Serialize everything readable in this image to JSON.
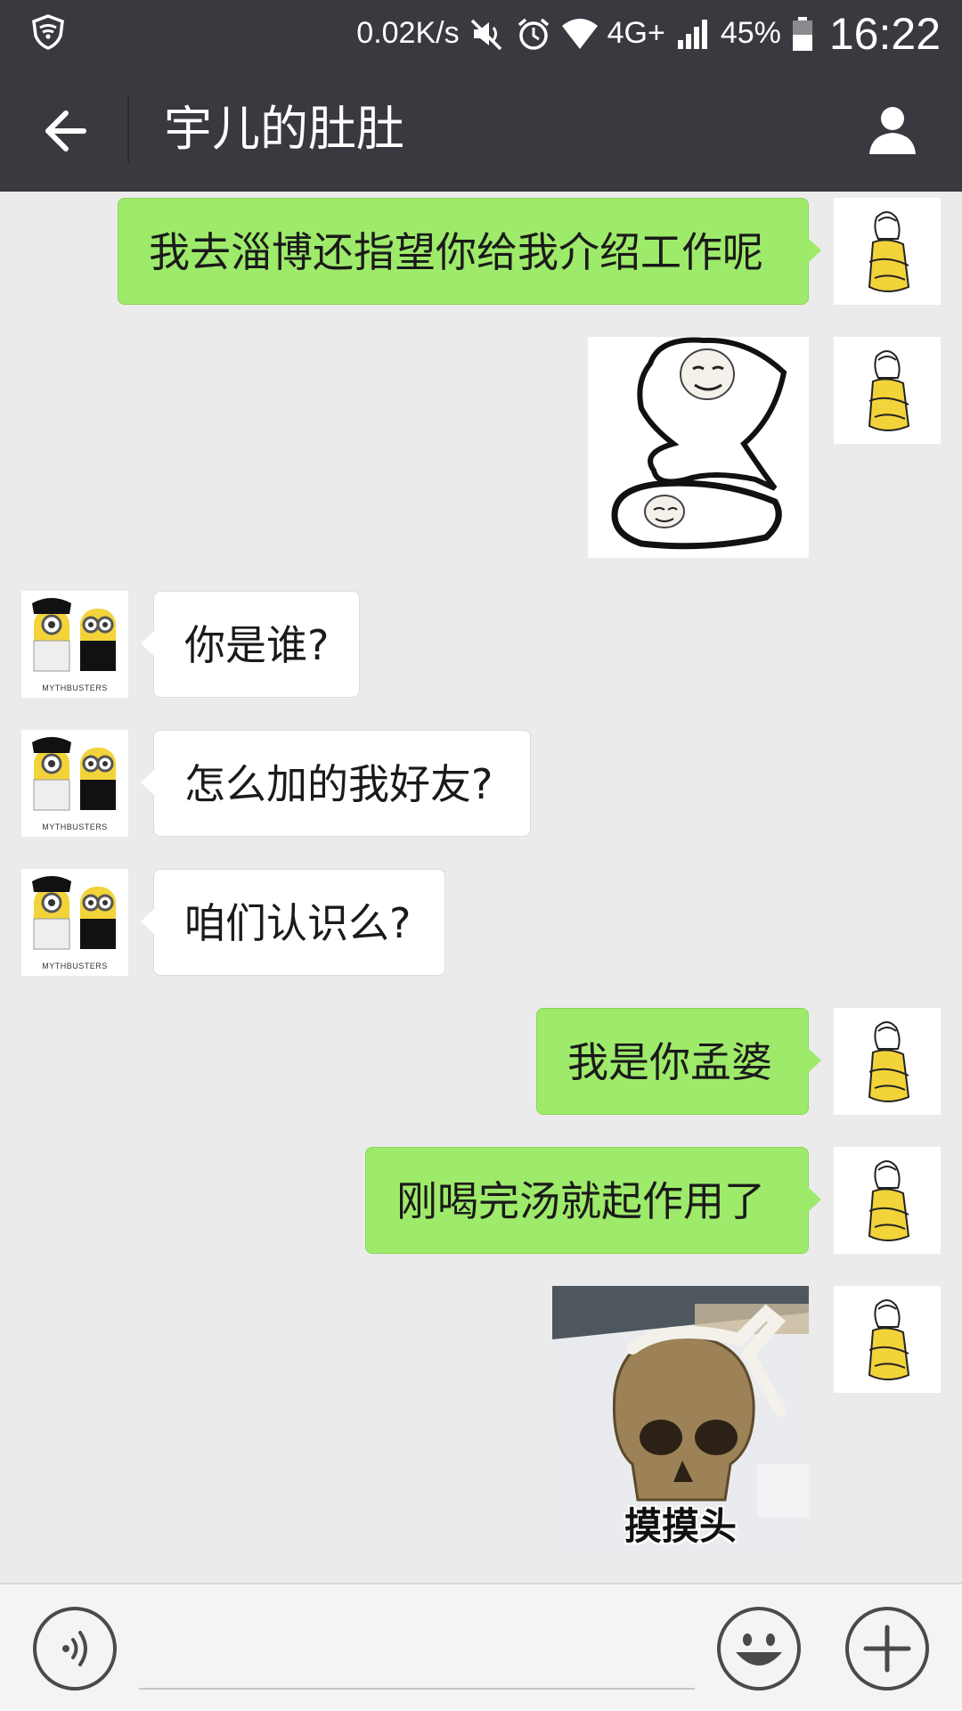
{
  "status_bar": {
    "network_speed": "0.02K/s",
    "network_type": "4G+",
    "battery": "45%",
    "time": "16:22"
  },
  "nav": {
    "title": "宇儿的肚肚"
  },
  "messages": [
    {
      "side": "sent",
      "type": "text",
      "text": "我去淄博还指望你给我介绍工作呢"
    },
    {
      "side": "sent",
      "type": "sticker",
      "icon": "meme-face-sticker"
    },
    {
      "side": "received",
      "type": "text",
      "text": "你是谁?"
    },
    {
      "side": "received",
      "type": "text",
      "text": "怎么加的我好友?"
    },
    {
      "side": "received",
      "type": "text",
      "text": "咱们认识么?"
    },
    {
      "side": "sent",
      "type": "text",
      "text": "我是你孟婆"
    },
    {
      "side": "sent",
      "type": "text",
      "text": "刚喝完汤就起作用了"
    },
    {
      "side": "sent",
      "type": "sticker",
      "icon": "skull-sticker",
      "caption": "摸摸头"
    }
  ],
  "avatars": {
    "sent_icon": "girl-avatar",
    "received_icon": "minions-avatar",
    "received_caption": "MYTHBUSTERS"
  },
  "input_bar": {
    "placeholder": "",
    "voice_icon": "voice-icon",
    "emoji_icon": "emoji-icon",
    "plus_icon": "plus-icon"
  },
  "colors": {
    "header_bg": "#393a3f",
    "chat_bg": "#ebebeb",
    "sent_bubble": "#9eea6a",
    "received_bubble": "#ffffff"
  }
}
